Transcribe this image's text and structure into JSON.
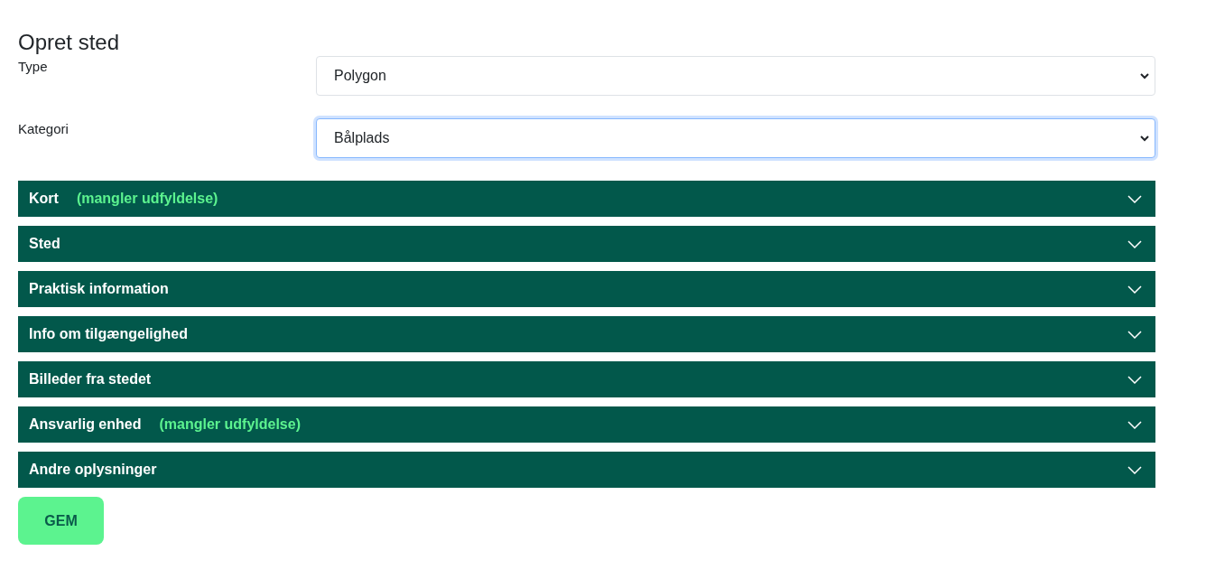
{
  "title": "Opret sted",
  "fields": [
    {
      "label": "Type",
      "value": "Polygon",
      "focused": false
    },
    {
      "label": "Kategori",
      "value": "Bålplads",
      "focused": true
    }
  ],
  "sections": [
    {
      "title": "Kort",
      "warning": "(mangler udfyldelse)",
      "expanded": false
    },
    {
      "title": "Sted",
      "expanded": false
    },
    {
      "title": "Praktisk information",
      "expanded": false
    },
    {
      "title": "Info om tilgængelighed",
      "expanded": false
    },
    {
      "title": "Billeder fra stedet",
      "expanded": false
    },
    {
      "title": "Ansvarlig enhed",
      "warning": "(mangler udfyldelse)",
      "expanded": false
    },
    {
      "title": "Andre oplysninger",
      "expanded": false
    }
  ],
  "save_button": "GEM"
}
